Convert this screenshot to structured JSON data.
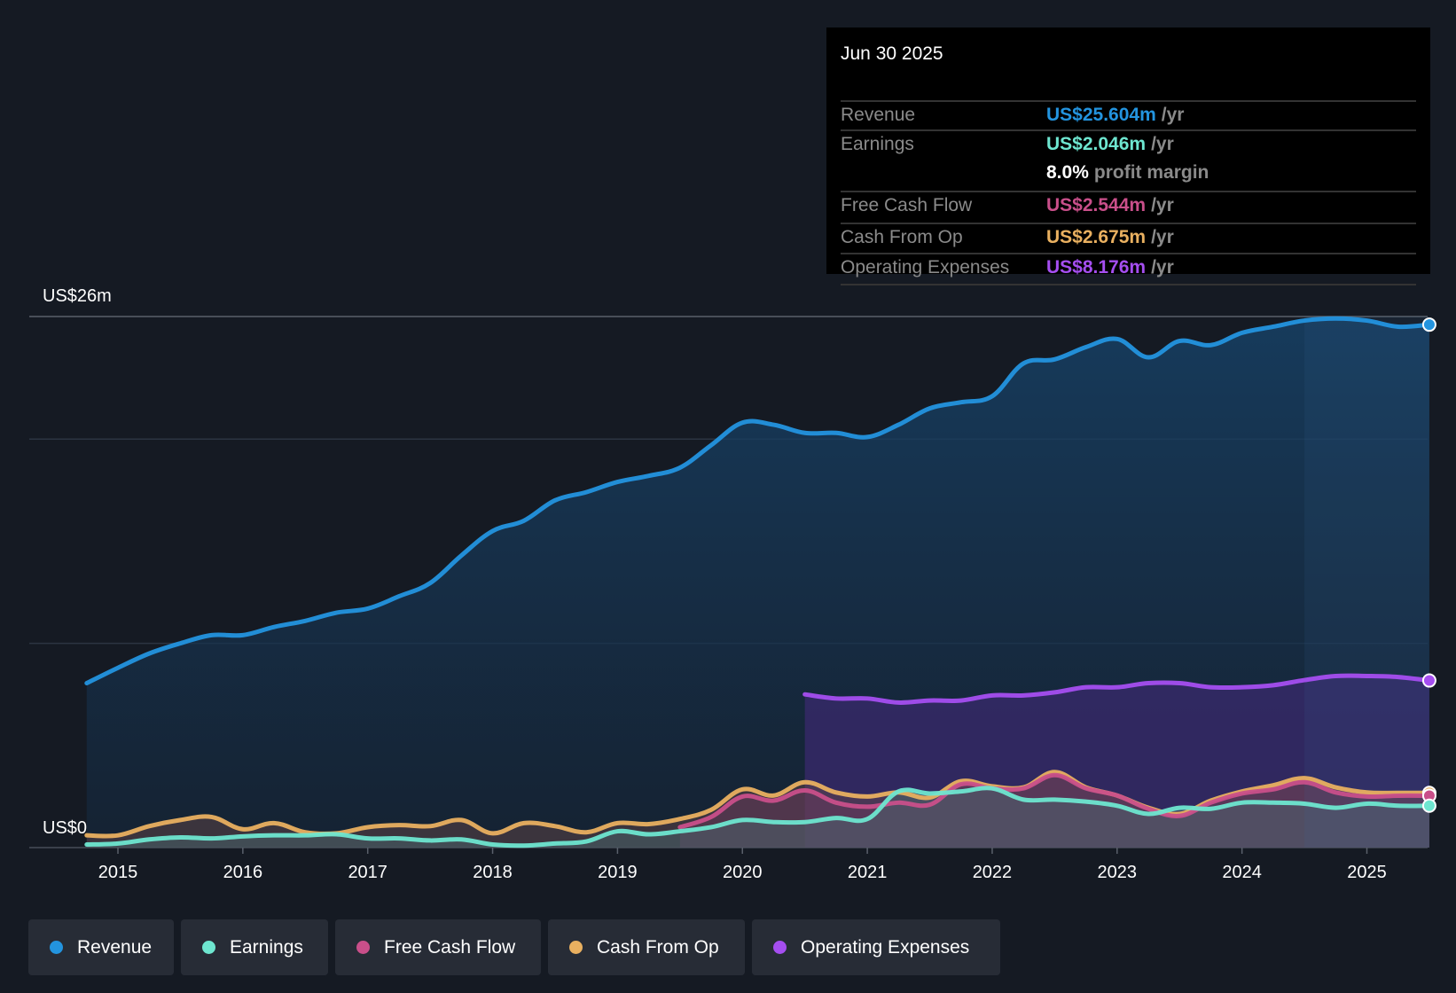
{
  "chart_data": {
    "type": "area",
    "title": "",
    "xlabel": "",
    "ylabel": "",
    "y_tick_labels": [
      "US$26m",
      "US$0"
    ],
    "ylim": [
      0,
      26
    ],
    "xlim": [
      2014.75,
      2025.5
    ],
    "x_tick_labels": [
      "2015",
      "2016",
      "2017",
      "2018",
      "2019",
      "2020",
      "2021",
      "2022",
      "2023",
      "2024",
      "2025"
    ],
    "grid": true,
    "highlight_from": 2024.5,
    "series": [
      {
        "name": "Revenue",
        "color": "#2394df",
        "x_start": 2014.75,
        "step": 0.25,
        "values": [
          8.05,
          8.8,
          9.5,
          10.0,
          10.4,
          10.4,
          10.8,
          11.1,
          11.5,
          11.7,
          12.3,
          12.95,
          14.3,
          15.5,
          16.0,
          17.0,
          17.4,
          17.9,
          18.2,
          18.6,
          19.7,
          20.8,
          20.7,
          20.3,
          20.3,
          20.1,
          20.7,
          21.5,
          21.8,
          22.1,
          23.7,
          23.9,
          24.5,
          24.9,
          24.0,
          24.8,
          24.6,
          25.2,
          25.5,
          25.8,
          25.9,
          25.8,
          25.5,
          25.6
        ]
      },
      {
        "name": "Operating Expenses",
        "color": "#a54ef0",
        "x_start": 2020.5,
        "step": 0.25,
        "values": [
          7.5,
          7.3,
          7.3,
          7.1,
          7.2,
          7.2,
          7.45,
          7.45,
          7.6,
          7.85,
          7.85,
          8.05,
          8.05,
          7.85,
          7.85,
          7.95,
          8.2,
          8.4,
          8.4,
          8.35,
          8.18
        ]
      },
      {
        "name": "Cash From Op",
        "color": "#e9b060",
        "x_start": 2014.75,
        "step": 0.25,
        "values": [
          0.6,
          0.6,
          1.05,
          1.35,
          1.5,
          0.9,
          1.2,
          0.75,
          0.7,
          1.0,
          1.1,
          1.05,
          1.35,
          0.7,
          1.2,
          1.05,
          0.75,
          1.2,
          1.15,
          1.4,
          1.85,
          2.85,
          2.55,
          3.2,
          2.7,
          2.5,
          2.7,
          2.45,
          3.25,
          3.0,
          2.95,
          3.7,
          2.95,
          2.55,
          1.95,
          1.65,
          2.3,
          2.75,
          3.05,
          3.4,
          2.95,
          2.7,
          2.68,
          2.68
        ]
      },
      {
        "name": "Free Cash Flow",
        "color": "#c94f8a",
        "x_start": 2019.5,
        "step": 0.25,
        "values": [
          1.0,
          1.5,
          2.5,
          2.3,
          2.8,
          2.2,
          2.0,
          2.2,
          2.1,
          3.1,
          2.9,
          2.9,
          3.55,
          2.9,
          2.55,
          1.9,
          1.55,
          2.2,
          2.65,
          2.85,
          3.2,
          2.7,
          2.5,
          2.54,
          2.54
        ]
      },
      {
        "name": "Earnings",
        "color": "#6ee6d0",
        "x_start": 2014.75,
        "step": 0.25,
        "values": [
          0.15,
          0.2,
          0.4,
          0.5,
          0.45,
          0.55,
          0.6,
          0.6,
          0.65,
          0.45,
          0.45,
          0.35,
          0.4,
          0.15,
          0.1,
          0.2,
          0.3,
          0.8,
          0.65,
          0.8,
          1.0,
          1.35,
          1.25,
          1.25,
          1.45,
          1.4,
          2.75,
          2.65,
          2.75,
          2.9,
          2.35,
          2.35,
          2.25,
          2.05,
          1.65,
          1.95,
          1.9,
          2.2,
          2.2,
          2.15,
          1.95,
          2.15,
          2.05,
          2.05
        ]
      }
    ]
  },
  "tooltip": {
    "date": "Jun 30 2025",
    "rows": [
      {
        "label": "Revenue",
        "value": "US$25.604m",
        "unit": "/yr",
        "color": "#2394df"
      },
      {
        "label": "Earnings",
        "value": "US$2.046m",
        "unit": "/yr",
        "color": "#6ee6d0"
      },
      {
        "label": "",
        "value": "8.0%",
        "unit": "profit margin",
        "color": "#ffffff"
      },
      {
        "label": "Free Cash Flow",
        "value": "US$2.544m",
        "unit": "/yr",
        "color": "#c94f8a"
      },
      {
        "label": "Cash From Op",
        "value": "US$2.675m",
        "unit": "/yr",
        "color": "#e9b060"
      },
      {
        "label": "Operating Expenses",
        "value": "US$8.176m",
        "unit": "/yr",
        "color": "#a54ef0"
      }
    ]
  },
  "legend": [
    {
      "label": "Revenue",
      "color": "#2394df"
    },
    {
      "label": "Earnings",
      "color": "#6ee6d0"
    },
    {
      "label": "Free Cash Flow",
      "color": "#c94f8a"
    },
    {
      "label": "Cash From Op",
      "color": "#e9b060"
    },
    {
      "label": "Operating Expenses",
      "color": "#a54ef0"
    }
  ]
}
